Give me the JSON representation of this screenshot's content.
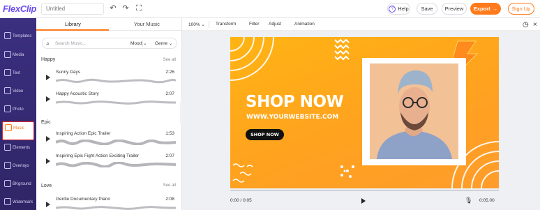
{
  "app": {
    "logo": "FlexClip",
    "project_title_placeholder": "Untitled"
  },
  "topbar": {
    "help_label": "Help",
    "save_label": "Save",
    "preview_label": "Preview",
    "export_label": "Export",
    "signup_label": "Sign Up"
  },
  "leftnav": {
    "items": [
      {
        "label": "Templates",
        "icon": "templates-icon"
      },
      {
        "label": "Media",
        "icon": "media-icon"
      },
      {
        "label": "Text",
        "icon": "text-icon"
      },
      {
        "label": "Video",
        "icon": "video-icon"
      },
      {
        "label": "Photo",
        "icon": "photo-icon"
      },
      {
        "label": "Music",
        "icon": "music-icon",
        "active": true
      },
      {
        "label": "Elements",
        "icon": "elements-icon"
      },
      {
        "label": "Overlays",
        "icon": "overlays-icon"
      },
      {
        "label": "BKground",
        "icon": "background-icon"
      },
      {
        "label": "Watermark",
        "icon": "watermark-icon"
      }
    ]
  },
  "library": {
    "tabs": [
      "Library",
      "Your Music"
    ],
    "search_placeholder": "Search Music...",
    "mood_label": "Mood",
    "genre_label": "Genre",
    "sections": [
      {
        "title": "Happy",
        "see_all": "See all",
        "tracks": [
          {
            "name": "Sunny Days",
            "duration": "2:26"
          },
          {
            "name": "Happy Acoustic Story",
            "duration": "2:07"
          }
        ]
      },
      {
        "title": "Epic",
        "see_all": "See all",
        "tracks": [
          {
            "name": "Inspiring Action Epic Trailer",
            "duration": "1:53"
          },
          {
            "name": "Inspiring Epic Fight Action Exciting Trailer",
            "duration": "2:07"
          }
        ]
      },
      {
        "title": "Love",
        "see_all": "See all",
        "tracks": [
          {
            "name": "Gentle Documentary Piano",
            "duration": "2:08"
          }
        ]
      }
    ]
  },
  "editor_toolbar": {
    "zoom": "100%",
    "items": [
      "Transform",
      "Filter",
      "Adjust",
      "Animation"
    ]
  },
  "canvas": {
    "headline": "SHOP NOW",
    "website": "WWW.YOURWEBSITE.COM",
    "cta": "SHOP NOW",
    "colors": {
      "background": "#ffa81a",
      "accent": "#ff7a1a"
    }
  },
  "playback": {
    "current": "0:00 / 0:05",
    "duration": "0:05.00"
  }
}
